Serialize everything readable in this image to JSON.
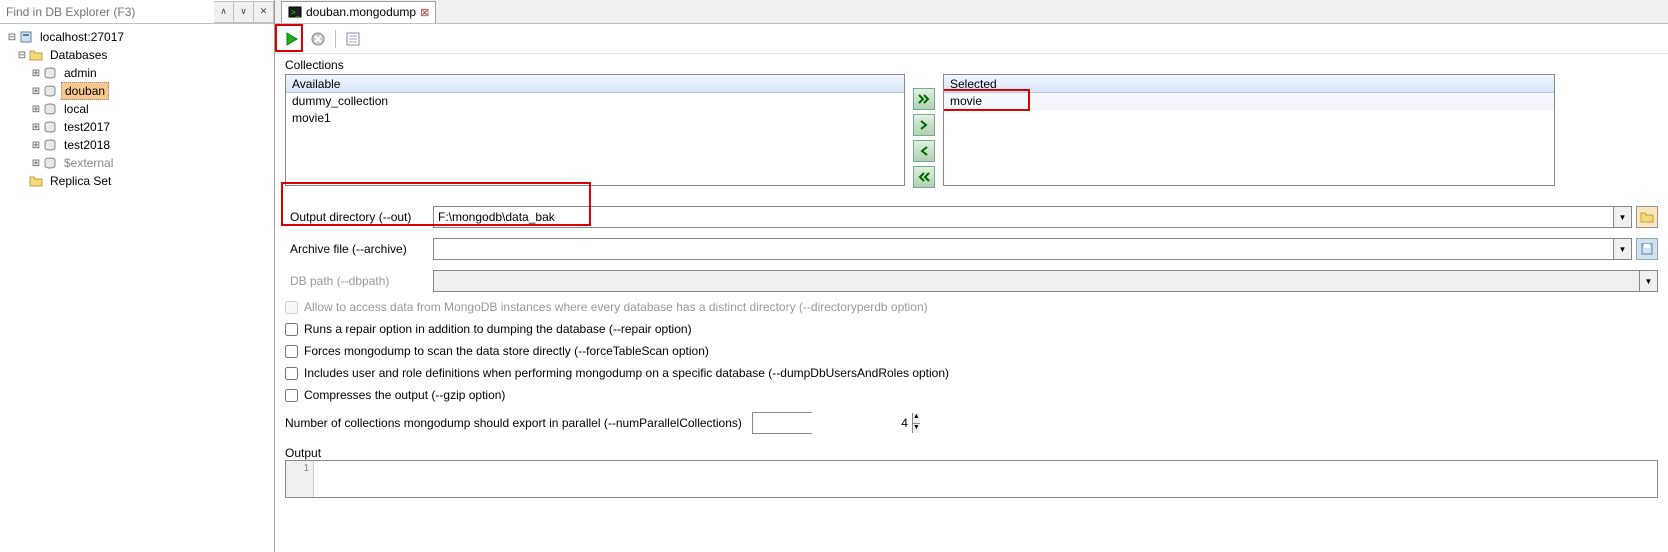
{
  "sidebar": {
    "find_placeholder": "Find in DB Explorer (F3)",
    "host": "localhost:27017",
    "databases_label": "Databases",
    "dbs": [
      "admin",
      "douban",
      "local",
      "test2017",
      "test2018",
      "$external"
    ],
    "selected_db": "douban",
    "replica_label": "Replica Set"
  },
  "tab": {
    "title": "douban.mongodump"
  },
  "collections": {
    "title": "Collections",
    "available_header": "Available",
    "available_items": [
      "dummy_collection",
      "movie1"
    ],
    "selected_header": "Selected",
    "selected_items": [
      "movie"
    ]
  },
  "form": {
    "output_dir_label": "Output directory (--out)",
    "output_dir_value": "F:\\mongodb\\data_bak",
    "archive_label": "Archive file (--archive)",
    "archive_value": "",
    "dbpath_label": "DB path (--dbpath)",
    "dbpath_value": ""
  },
  "checks": {
    "directoryperdb": "Allow to access data from MongoDB instances where every database has a distinct directory (--directoryperdb option)",
    "repair": "Runs a repair option in addition to dumping the database (--repair option)",
    "forcetablescan": "Forces mongodump to scan the data store directly (--forceTableScan option)",
    "dumpusers": "Includes user and role definitions when performing mongodump on a specific database (--dumpDbUsersAndRoles option)",
    "gzip": "Compresses the output (--gzip option)"
  },
  "parallel": {
    "label": "Number of collections mongodump should export in parallel (--numParallelCollections)",
    "value": "4"
  },
  "output": {
    "label": "Output",
    "line_no": "1"
  }
}
